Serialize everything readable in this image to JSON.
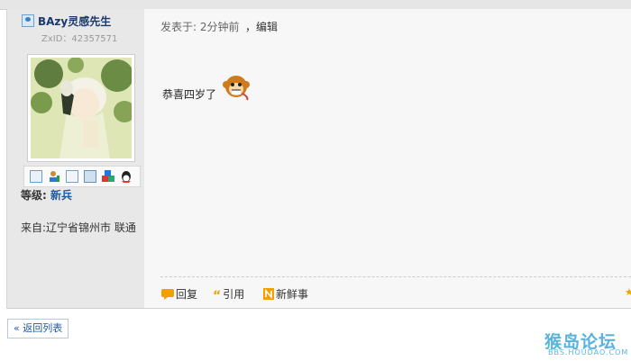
{
  "user": {
    "name": "BAzy灵感先生",
    "id_text": "ZxID：42357571",
    "level_label": "等级:",
    "level_value": "新兵",
    "location": "来自:辽宁省锦州市 联通"
  },
  "user_actions": [
    "mail-icon",
    "add-friend-icon",
    "profile-icon",
    "photo-icon",
    "blocks-icon",
    "qq-icon"
  ],
  "post": {
    "posted_text": "发表于: 2分钟前",
    "edit_text": "，编辑",
    "content": "恭喜四岁了",
    "emoji": "monkey-emoji"
  },
  "post_actions": {
    "reply": "回复",
    "quote": "引用",
    "news": "新鲜事"
  },
  "back_label": "« 返回列表",
  "watermark": {
    "main": "猴岛论坛",
    "sub": "BBS.HOUDAO.COM"
  },
  "colors": {
    "accent_blue": "#1f5aa8",
    "icon_orange": "#f0a000",
    "watermark_blue": "#5ab3dc"
  }
}
